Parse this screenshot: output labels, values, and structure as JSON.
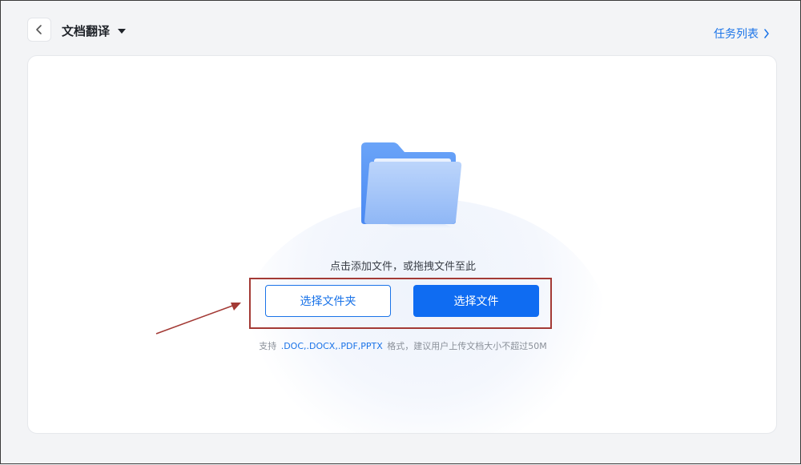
{
  "header": {
    "title": "文档翻译",
    "task_list_label": "任务列表"
  },
  "upload": {
    "hint": "点击添加文件，或拖拽文件至此",
    "select_folder_label": "选择文件夹",
    "select_file_label": "选择文件",
    "support_prefix": "支持",
    "support_formats": ".DOC,.DOCX,.PDF,PPTX",
    "support_suffix": "格式，建议用户上传文档大小不超过50M"
  },
  "icons": {
    "back": "chevron-left-icon",
    "title_dropdown": "caret-down-icon",
    "task_list": "chevron-right-icon",
    "folder": "folder-icon"
  },
  "colors": {
    "accent": "#1a73e8",
    "primary_button": "#0f6cf2",
    "annotation": "#a33a35"
  }
}
